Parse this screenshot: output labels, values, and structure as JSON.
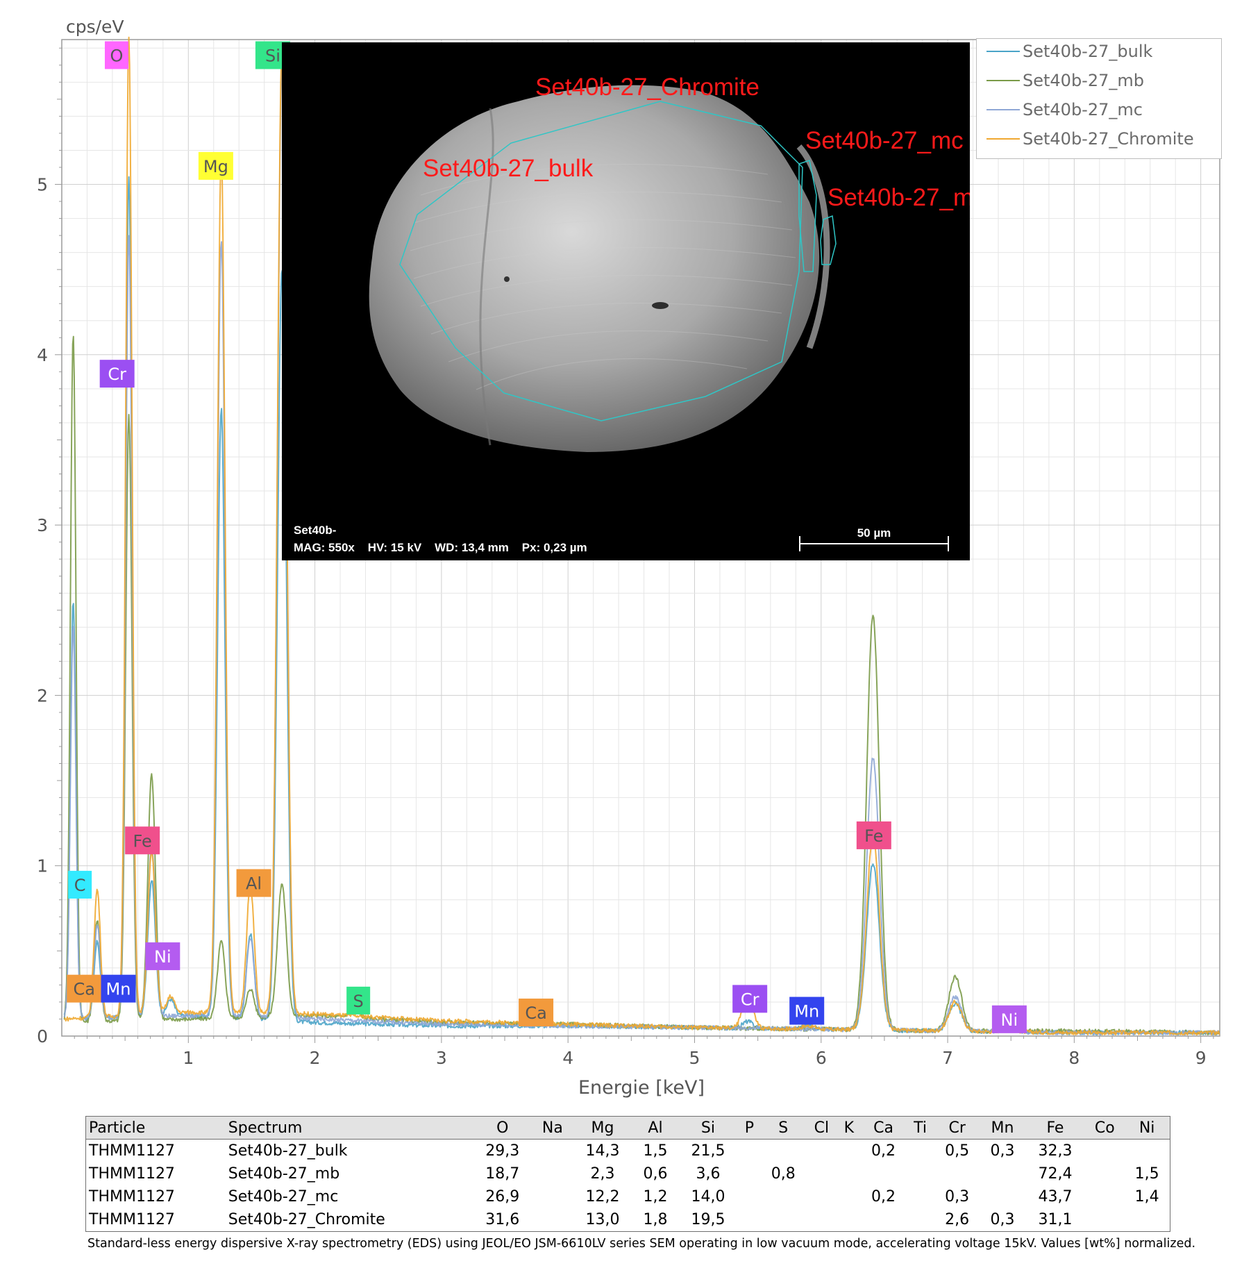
{
  "chart_data": {
    "type": "line",
    "ylabel": "cps/eV",
    "xlabel": "Energie [keV]",
    "xlim": [
      0.0,
      9.15
    ],
    "ylim": [
      0,
      5.85
    ],
    "xticks": [
      "1",
      "2",
      "3",
      "4",
      "5",
      "6",
      "7",
      "8",
      "9"
    ],
    "yticks": [
      "0",
      "1",
      "2",
      "3",
      "4",
      "5"
    ],
    "grid": true,
    "legend_position": "top-right",
    "series": [
      {
        "name": "Set40b-27_bulk",
        "color": "#4aa4c8",
        "baseline": [
          [
            0.02,
            0.1
          ],
          [
            1,
            0.12
          ],
          [
            2,
            0.08
          ],
          [
            3,
            0.06
          ],
          [
            4,
            0.06
          ],
          [
            5,
            0.05
          ],
          [
            6,
            0.04
          ],
          [
            7,
            0.03
          ],
          [
            8,
            0.02
          ],
          [
            9.15,
            0.02
          ]
        ],
        "peaks": [
          [
            0.09,
            2.45,
            0.022
          ],
          [
            0.28,
            0.45,
            0.025
          ],
          [
            0.53,
            4.93,
            0.025
          ],
          [
            0.71,
            0.8,
            0.03
          ],
          [
            0.86,
            0.1,
            0.03
          ],
          [
            1.26,
            3.57,
            0.03
          ],
          [
            1.49,
            0.5,
            0.03
          ],
          [
            1.74,
            4.41,
            0.035
          ],
          [
            5.42,
            0.04,
            0.04
          ],
          [
            5.9,
            0.02,
            0.05
          ],
          [
            6.41,
            0.98,
            0.05
          ],
          [
            7.06,
            0.16,
            0.05
          ],
          [
            7.48,
            0.03,
            0.05
          ]
        ]
      },
      {
        "name": "Set40b-27_mb",
        "color": "#7a9a48",
        "baseline": [
          [
            0.02,
            0.08
          ],
          [
            1,
            0.1
          ],
          [
            2,
            0.12
          ],
          [
            3,
            0.08
          ],
          [
            4,
            0.07
          ],
          [
            5,
            0.05
          ],
          [
            6,
            0.04
          ],
          [
            7,
            0.03
          ],
          [
            8,
            0.03
          ],
          [
            9.15,
            0.02
          ]
        ],
        "peaks": [
          [
            0.09,
            4.05,
            0.022
          ],
          [
            0.28,
            0.6,
            0.025
          ],
          [
            0.53,
            3.55,
            0.025
          ],
          [
            0.71,
            1.44,
            0.03
          ],
          [
            1.26,
            0.45,
            0.03
          ],
          [
            1.49,
            0.17,
            0.03
          ],
          [
            1.74,
            0.78,
            0.035
          ],
          [
            2.31,
            0.05,
            0.04
          ],
          [
            6.41,
            2.43,
            0.05
          ],
          [
            7.06,
            0.32,
            0.05
          ],
          [
            7.48,
            0.06,
            0.05
          ]
        ]
      },
      {
        "name": "Set40b-27_mc",
        "color": "#8fa7d6",
        "baseline": [
          [
            0.02,
            0.1
          ],
          [
            1,
            0.12
          ],
          [
            2,
            0.1
          ],
          [
            3,
            0.07
          ],
          [
            4,
            0.06
          ],
          [
            5,
            0.05
          ],
          [
            6,
            0.04
          ],
          [
            7,
            0.03
          ],
          [
            8,
            0.02
          ],
          [
            9.15,
            0.02
          ]
        ],
        "peaks": [
          [
            0.09,
            2.3,
            0.022
          ],
          [
            0.28,
            0.55,
            0.025
          ],
          [
            0.53,
            4.6,
            0.025
          ],
          [
            0.71,
            1.0,
            0.03
          ],
          [
            1.26,
            4.56,
            0.03
          ],
          [
            1.49,
            0.47,
            0.03
          ],
          [
            1.74,
            5.6,
            0.035
          ],
          [
            6.41,
            1.6,
            0.05
          ],
          [
            7.06,
            0.2,
            0.05
          ],
          [
            7.48,
            0.05,
            0.05
          ]
        ]
      },
      {
        "name": "Set40b-27_Chromite",
        "color": "#f0a830",
        "baseline": [
          [
            0.02,
            0.1
          ],
          [
            1,
            0.14
          ],
          [
            2,
            0.13
          ],
          [
            3,
            0.09
          ],
          [
            4,
            0.07
          ],
          [
            5,
            0.05
          ],
          [
            6,
            0.04
          ],
          [
            7,
            0.03
          ],
          [
            8,
            0.02
          ],
          [
            9.15,
            0.02
          ]
        ],
        "peaks": [
          [
            0.09,
            0.0,
            0.022
          ],
          [
            0.28,
            0.75,
            0.025
          ],
          [
            0.53,
            5.75,
            0.025
          ],
          [
            0.71,
            0.95,
            0.03
          ],
          [
            0.86,
            0.1,
            0.03
          ],
          [
            1.26,
            5.05,
            0.03
          ],
          [
            1.49,
            0.75,
            0.03
          ],
          [
            1.74,
            5.7,
            0.035
          ],
          [
            5.42,
            0.2,
            0.04
          ],
          [
            5.9,
            0.02,
            0.05
          ],
          [
            6.41,
            1.14,
            0.05
          ],
          [
            7.06,
            0.17,
            0.05
          ],
          [
            7.48,
            0.03,
            0.05
          ]
        ]
      }
    ],
    "element_labels": [
      {
        "text": "O",
        "x": 0.34,
        "y": 5.84,
        "color": "#ff66ff"
      },
      {
        "text": "Si",
        "x": 1.53,
        "y": 5.84,
        "color": "#33e58a"
      },
      {
        "text": "Mg",
        "x": 1.08,
        "y": 5.19,
        "color": "#ffff33"
      },
      {
        "text": "Cr",
        "x": 0.3,
        "y": 3.97,
        "color": "#9b4ff2"
      },
      {
        "text": "Fe",
        "x": 0.5,
        "y": 1.23,
        "color": "#f0508c"
      },
      {
        "text": "C",
        "x": 0.05,
        "y": 0.97,
        "color": "#33eaff"
      },
      {
        "text": "Al",
        "x": 1.38,
        "y": 0.98,
        "color": "#f29a3c"
      },
      {
        "text": "Ni",
        "x": 0.66,
        "y": 0.55,
        "color": "#b45cf0"
      },
      {
        "text": "Ca",
        "x": 0.04,
        "y": 0.36,
        "color": "#f29a3c"
      },
      {
        "text": "Mn",
        "x": 0.31,
        "y": 0.36,
        "color": "#3344ee"
      },
      {
        "text": "S",
        "x": 2.25,
        "y": 0.29,
        "color": "#33e58a"
      },
      {
        "text": "Ca",
        "x": 3.61,
        "y": 0.22,
        "color": "#f29a3c"
      },
      {
        "text": "Cr",
        "x": 5.3,
        "y": 0.3,
        "color": "#9b4ff2"
      },
      {
        "text": "Mn",
        "x": 5.75,
        "y": 0.23,
        "color": "#3344ee"
      },
      {
        "text": "Fe",
        "x": 6.28,
        "y": 1.26,
        "color": "#f0508c"
      },
      {
        "text": "Ni",
        "x": 7.35,
        "y": 0.18,
        "color": "#b45cf0"
      }
    ]
  },
  "sem_image": {
    "region_labels": [
      "Set40b-27_Chromite",
      "Set40b-27_bulk",
      "Set40b-27_mc",
      "Set40b-27_m"
    ],
    "info_line1": "Set40b-",
    "info_line2": "MAG: 550x    HV: 15 kV    WD: 13,4 mm    Px: 0,23 µm",
    "scale_label": "50 µm"
  },
  "table": {
    "headers": [
      "Particle",
      "Spectrum",
      "O",
      "Na",
      "Mg",
      "Al",
      "Si",
      "P",
      "S",
      "Cl",
      "K",
      "Ca",
      "Ti",
      "Cr",
      "Mn",
      "Fe",
      "Co",
      "Ni"
    ],
    "rows": [
      [
        "THMM1127",
        "Set40b-27_bulk",
        "29,3",
        "",
        "14,3",
        "1,5",
        "21,5",
        "",
        "",
        "",
        "",
        "0,2",
        "",
        "0,5",
        "0,3",
        "32,3",
        "",
        ""
      ],
      [
        "THMM1127",
        "Set40b-27_mb",
        "18,7",
        "",
        "2,3",
        "0,6",
        "3,6",
        "",
        "0,8",
        "",
        "",
        "",
        "",
        "",
        "",
        "72,4",
        "",
        "1,5"
      ],
      [
        "THMM1127",
        "Set40b-27_mc",
        "26,9",
        "",
        "12,2",
        "1,2",
        "14,0",
        "",
        "",
        "",
        "",
        "0,2",
        "",
        "0,3",
        "",
        "43,7",
        "",
        "1,4"
      ],
      [
        "THMM1127",
        "Set40b-27_Chromite",
        "31,6",
        "",
        "13,0",
        "1,8",
        "19,5",
        "",
        "",
        "",
        "",
        "",
        "",
        "2,6",
        "0,3",
        "31,1",
        "",
        ""
      ]
    ]
  },
  "caption": "Standard-less energy dispersive X-ray spectrometry (EDS) using JEOL/EO JSM-6610LV series SEM operating in low vacuum mode, accelerating voltage 15kV. Values [wt%] normalized."
}
